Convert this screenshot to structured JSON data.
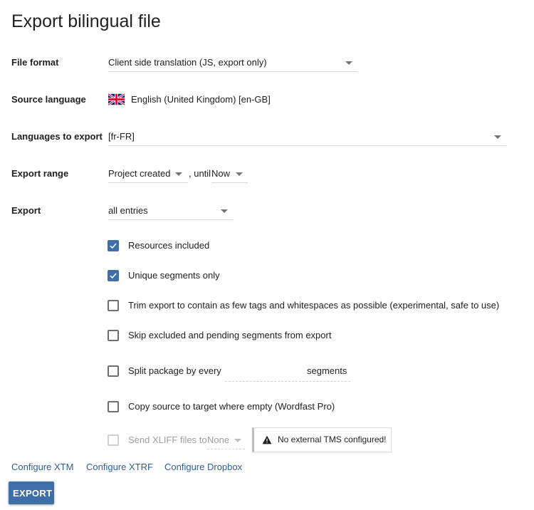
{
  "page": {
    "title": "Export bilingual file"
  },
  "fields": {
    "file_format": {
      "label": "File format",
      "value": "Client side translation (JS, export only)"
    },
    "source_language": {
      "label": "Source language",
      "value": "English (United Kingdom) [en-GB]",
      "flag_icon": "uk-flag-icon"
    },
    "languages_to_export": {
      "label": "Languages to export",
      "value": "[fr-FR]"
    },
    "export_range": {
      "label": "Export range",
      "from_value": "Project created",
      "until_text": ", until",
      "until_value": "Now"
    },
    "export": {
      "label": "Export",
      "value": "all entries"
    }
  },
  "options": {
    "resources_included": {
      "label": "Resources included",
      "checked": true
    },
    "unique_segments_only": {
      "label": "Unique segments only",
      "checked": true
    },
    "trim_export": {
      "label": "Trim export to contain as few tags and whitespaces as possible (experimental, safe to use)",
      "checked": false
    },
    "skip_excluded": {
      "label": "Skip excluded and pending segments from export",
      "checked": false
    },
    "split_package": {
      "label": "Split package by every",
      "suffix": "segments",
      "value": "",
      "checked": false
    },
    "copy_source": {
      "label": "Copy source to target where empty (Wordfast Pro)",
      "checked": false
    },
    "send_xliff": {
      "label": "Send XLIFF files to",
      "target_value": "None",
      "checked": false,
      "disabled": true
    }
  },
  "tooltip": {
    "text": "No external TMS configured!",
    "icon": "warning-icon"
  },
  "links": {
    "configure_xtm": "Configure XTM",
    "configure_xtrf": "Configure XTRF",
    "configure_dropbox": "Configure Dropbox"
  },
  "actions": {
    "export_label": "EXPORT"
  },
  "colors": {
    "accent": "#3f6fa8",
    "link": "#2e5f95",
    "text": "#212121",
    "disabled": "#9e9e9e"
  }
}
